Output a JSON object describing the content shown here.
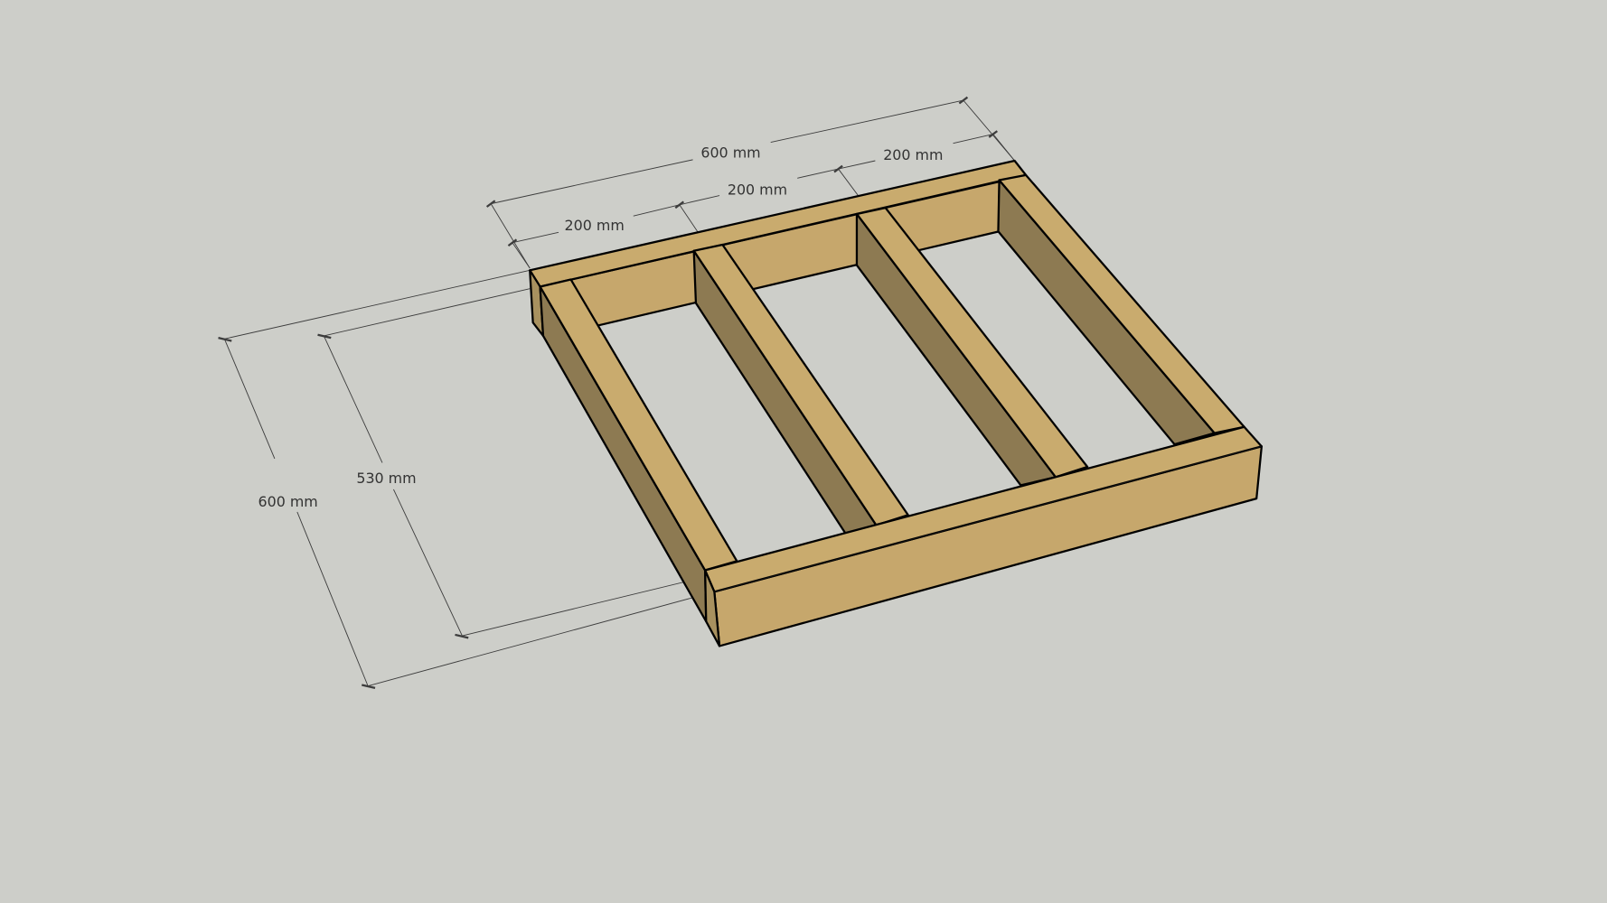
{
  "model": {
    "name": "wooden frame",
    "colors": {
      "background": "#cdcec9",
      "wood_top": "#c9ab6e",
      "wood_side": "#8d7a52",
      "wood_front": "#c6a76c"
    }
  },
  "dimensions": {
    "top_total": "600 mm",
    "spacing_1": "200 mm",
    "spacing_2": "200 mm",
    "spacing_3": "200 mm",
    "inner_depth": "530 mm",
    "total_depth": "600 mm"
  }
}
